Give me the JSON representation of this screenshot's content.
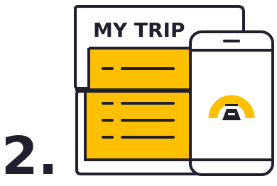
{
  "step": {
    "number": "2."
  },
  "document": {
    "title": "MY TRIP"
  },
  "colors": {
    "ink": "#1f1f2e",
    "accent": "#fdc000",
    "paper": "#ffffff"
  },
  "icons": {
    "phone": "smartphone-icon",
    "app_logo": "app-logo-icon"
  }
}
